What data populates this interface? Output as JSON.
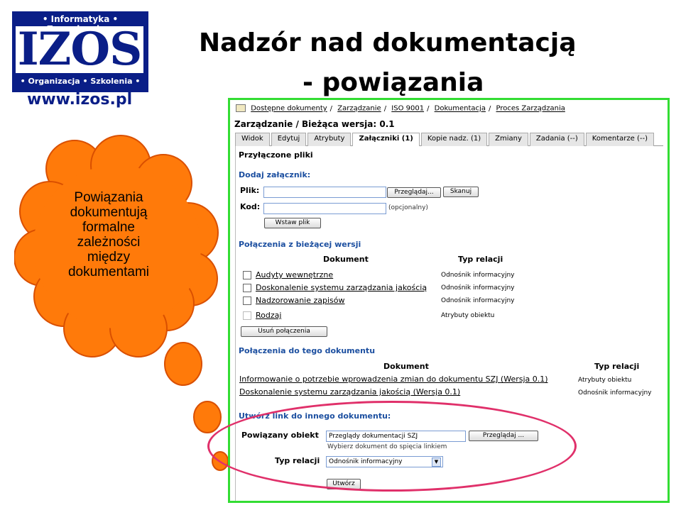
{
  "logo": {
    "top_text": "• Informatyka • Zarządzanie •",
    "word": "IZOS",
    "bottom_text": "• Organizacja • Szkolenia •",
    "url": "www.izos.pl"
  },
  "title": {
    "line1": "Nadzór nad dokumentacją",
    "line2": "- powiązania"
  },
  "cloud": {
    "text_lines": [
      "Powiązania",
      "dokumentują",
      "formalne",
      "zależności",
      "między",
      "dokumentami"
    ],
    "color": "#ff7a0a"
  },
  "app": {
    "breadcrumb": [
      "Dostępne dokumenty",
      "Zarządzanie",
      "ISO 9001",
      "Dokumentacja",
      "Proces Zarządzania"
    ],
    "header": "Zarządzanie / Bieżąca wersja: 0.1",
    "tabs": [
      {
        "label": "Widok",
        "active": false
      },
      {
        "label": "Edytuj",
        "active": false
      },
      {
        "label": "Atrybuty",
        "active": false
      },
      {
        "label": "Załączniki (1)",
        "active": true
      },
      {
        "label": "Kopie nadz. (1)",
        "active": false
      },
      {
        "label": "Zmiany",
        "active": false
      },
      {
        "label": "Zadania (--)",
        "active": false
      },
      {
        "label": "Komentarze (--)",
        "active": false
      }
    ],
    "attached_title": "Przyłączone pliki",
    "add_title": "Dodaj załącznik:",
    "file_label": "Plik:",
    "browse_label": "Przeglądaj...",
    "scan_label": "Skanuj",
    "code_label": "Kod:",
    "optional_note": "(opcjonalny)",
    "insert_label": "Wstaw plik",
    "conn_from_title": "Połączenia z bieżącej wersji",
    "col_document": "Dokument",
    "col_relation": "Typ relacji",
    "conn_from_rows": [
      {
        "doc": "Audyty wewnętrzne",
        "rel": "Odnośnik informacyjny",
        "linked": true
      },
      {
        "doc": "Doskonalenie systemu zarządzania jakością",
        "rel": "Odnośnik informacyjny",
        "linked": true
      },
      {
        "doc": "Nadzorowanie zapisów",
        "rel": "Odnośnik informacyjny",
        "linked": true
      },
      {
        "doc": "Rodzaj",
        "rel": "Atrybuty obiektu",
        "linked": true
      }
    ],
    "remove_label": "Usuń połączenia",
    "conn_to_title": "Połączenia do tego dokumentu",
    "conn_to_rows": [
      {
        "doc": "Informowanie o potrzebie wprowadzenia zmian do dokumentu SZJ (Wersja 0.1)",
        "rel": "Atrybuty obiektu"
      },
      {
        "doc": "Doskonalenie systemu zarządzania jakością (Wersja 0.1)",
        "rel": "Odnośnik informacyjny"
      }
    ],
    "create_link_title": "Utwórz link do innego dokumentu:",
    "related_label": "Powiązany obiekt",
    "related_value": "Przeglądy dokumentacji SZJ",
    "browse2_label": "Przeglądaj ...",
    "choose_note": "Wybierz dokument do spięcia linkiem",
    "relation_type_label": "Typ relacji",
    "relation_type_value": "Odnośnik informacyjny",
    "create_label": "Utwórz"
  },
  "colors": {
    "frame": "#33dd33",
    "ellipse": "#e0306a",
    "section_title": "#1c4fa0",
    "logo_blue": "#0a1e87"
  }
}
